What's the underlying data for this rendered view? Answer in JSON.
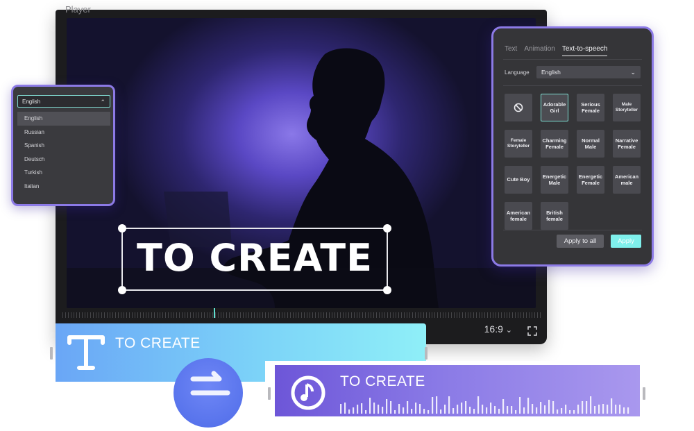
{
  "player": {
    "title": "Player",
    "overlay_text": "TO CREATE",
    "aspect_ratio": "16:9",
    "aspect_chevron": "⌵"
  },
  "language_dropdown": {
    "selected": "English",
    "options": [
      "English",
      "Russian",
      "Spanish",
      "Deutsch",
      "Turkish",
      "Italian"
    ]
  },
  "tts_panel": {
    "tabs": [
      "Text",
      "Animation",
      "Text-to-speech"
    ],
    "active_tab": "Text-to-speech",
    "language_label": "Language",
    "language_value": "English",
    "voices": [
      [
        "none-icon"
      ],
      [
        "Adorable",
        "Girl"
      ],
      [
        "Serious",
        "Female"
      ],
      [
        "Male",
        "Storyteller"
      ],
      [
        "Female",
        "Storyteller"
      ],
      [
        "Charming",
        "Female"
      ],
      [
        "Normal",
        "Male"
      ],
      [
        "Narrative",
        "Female"
      ],
      [
        "Cute Boy"
      ],
      [
        "Energetic",
        "Male"
      ],
      [
        "Energetic",
        "Female"
      ],
      [
        "American",
        "male"
      ],
      [
        "American",
        "female"
      ],
      [
        "British",
        "female"
      ]
    ],
    "selected_voice_index": 1,
    "apply_all_label": "Apply to all",
    "apply_label": "Apply"
  },
  "timeline": {
    "text_clip_label": "TO CREATE",
    "audio_clip_label": "TO CREATE"
  },
  "colors": {
    "accent_purple": "#8c7ae6",
    "accent_teal": "#7fe0d4",
    "text_clip": "#7cd3f8",
    "audio_clip": "#8a7ae6"
  }
}
